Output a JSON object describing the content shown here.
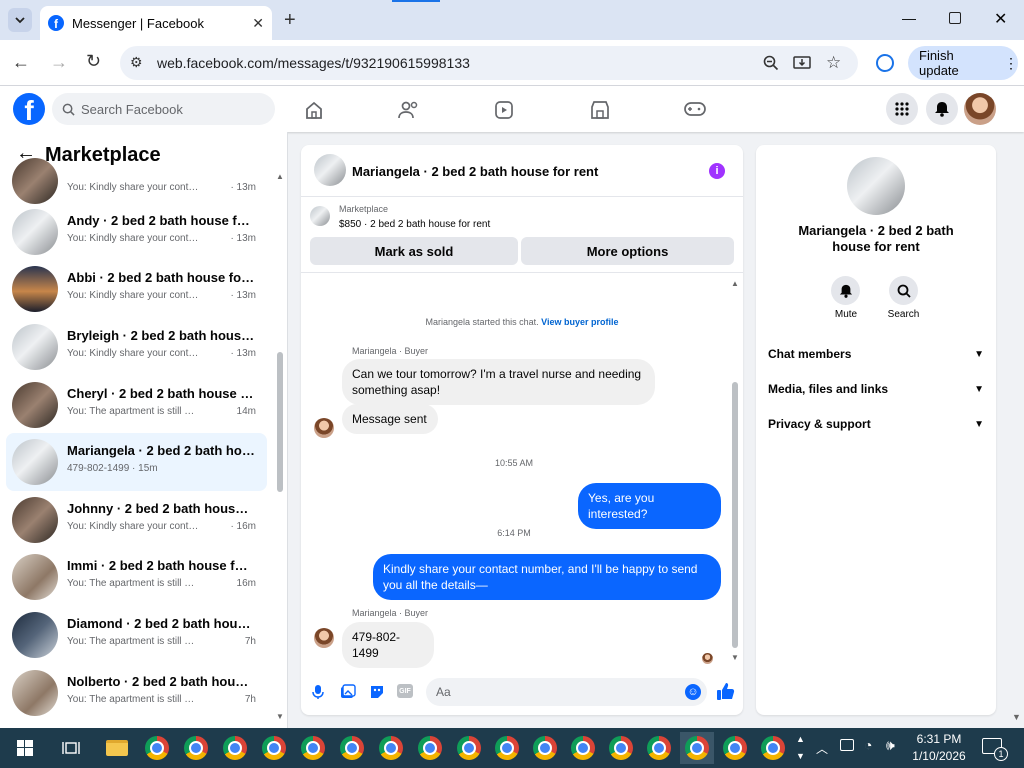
{
  "browser": {
    "tab_title": "Messenger | Facebook",
    "url": "web.facebook.com/messages/t/932190615998133",
    "finish_update": "Finish update"
  },
  "fb": {
    "search_placeholder": "Search Facebook"
  },
  "left": {
    "title": "Marketplace",
    "rows": [
      {
        "name": "",
        "preview": "You: Kindly share your contact n...",
        "time": "· 13m"
      },
      {
        "name": "Andy · 2 bed 2 bath house for r...",
        "preview": "You: Kindly share your contact n...",
        "time": "· 13m"
      },
      {
        "name": "Abbi · 2 bed 2 bath house for re...",
        "preview": "You: Kindly share your contact n...",
        "time": "· 13m"
      },
      {
        "name": "Bryleigh · 2 bed 2 bath house f...",
        "preview": "You: Kindly share your contact n...",
        "time": "· 13m"
      },
      {
        "name": "Cheryl · 2 bed 2 bath house for ...",
        "preview": "You: The apartment is still availa...",
        "time": "14m"
      },
      {
        "name": "Mariangela · 2 bed 2 bath hous...",
        "preview": "479-802-1499 · 15m",
        "time": ""
      },
      {
        "name": "Johnny · 2 bed 2 bath house for...",
        "preview": "You: Kindly share your contact n...",
        "time": "· 16m"
      },
      {
        "name": "Immi · 2 bed 2 bath house for r...",
        "preview": "You: The apartment is still availa...",
        "time": "16m"
      },
      {
        "name": "Diamond · 2 bed 2 bath house f...",
        "preview": "You: The apartment is still available...",
        "time": "7h"
      },
      {
        "name": "Nolberto · 2 bed 2 bath house f...",
        "preview": "You: The apartment is still available...",
        "time": "7h"
      }
    ]
  },
  "chat": {
    "title": "Mariangela · 2 bed 2 bath house for rent",
    "listing_label": "Marketplace",
    "listing_price": "$850 · 2 bed 2 bath house for rent",
    "mark_sold": "Mark as sold",
    "more_options": "More options",
    "started": "Mariangela started this chat.",
    "view_profile": "View buyer profile",
    "sender_label_1": "Mariangela · Buyer",
    "msg1": "Can we tour tomorrow? I'm a travel nurse and needing something asap!",
    "msg2": "Message sent",
    "time1": "10:55 AM",
    "msg3": "Yes, are you interested?",
    "time2": "6:14 PM",
    "msg4": "Kindly share your contact number, and I'll be happy to send you all the details—",
    "sender_label_2": "Mariangela · Buyer",
    "msg5": "479-802-1499",
    "input_placeholder": "Aa"
  },
  "info": {
    "title": "Mariangela · 2 bed 2 bath house for rent",
    "mute": "Mute",
    "search": "Search",
    "chat_members": "Chat members",
    "media": "Media, files and links",
    "privacy": "Privacy & support"
  },
  "taskbar": {
    "time": "6:31 PM",
    "date": "1/10/2026",
    "notif_count": "1"
  },
  "colors": {
    "accent": "#0a66ff",
    "fb_blue": "#0866ff",
    "info_purple": "#a033ff"
  }
}
